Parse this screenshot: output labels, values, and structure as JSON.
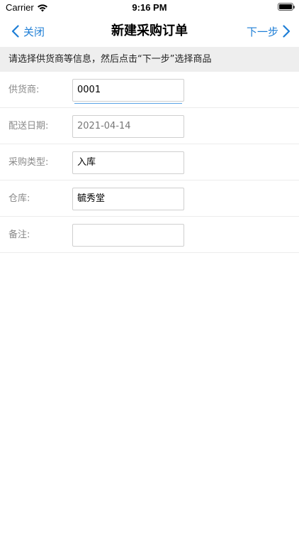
{
  "status_bar": {
    "carrier": "Carrier",
    "time": "9:16 PM",
    "wifi_icon": "wifi-icon",
    "battery_icon": "battery-icon"
  },
  "nav": {
    "back_label": "关闭",
    "back_icon": "chevron-left-icon",
    "title": "新建采购订单",
    "next_label": "下一步",
    "next_icon": "chevron-right-icon",
    "accent_color": "#1e7ed6"
  },
  "hint": {
    "text": "请选择供货商等信息，然后点击“下一步”选择商品"
  },
  "form": {
    "supplier": {
      "label": "供货商:",
      "value": "0001"
    },
    "delivery_date": {
      "label": "配送日期:",
      "value": "2021-04-14"
    },
    "purchase_type": {
      "label": "采购类型:",
      "value": "入库"
    },
    "warehouse": {
      "label": "仓库:",
      "value": "毓秀堂"
    },
    "remark": {
      "label": "备注:",
      "value": ""
    }
  }
}
